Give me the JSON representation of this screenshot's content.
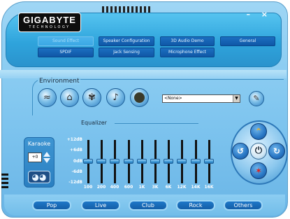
{
  "app": {
    "brand": "GIGABYTE",
    "brand_sub": "TECHNOLOGY",
    "window_controls": "– ×"
  },
  "tabs": [
    {
      "label": "Sound Effect",
      "active": true
    },
    {
      "label": "Speaker Configuration",
      "active": false
    },
    {
      "label": "3D Audio Demo",
      "active": false
    },
    {
      "label": "General",
      "active": false
    },
    {
      "label": "SPDIF",
      "active": false
    },
    {
      "label": "Jack Sensing",
      "active": false
    },
    {
      "label": "Microphone Effect",
      "active": false
    }
  ],
  "environment": {
    "title": "Environment",
    "selected": "<None>",
    "icons": [
      "stone-room-icon",
      "sewer-icon",
      "bathroom-icon",
      "theater-icon",
      "stadium-icon"
    ],
    "edit_icon": "edit-icon"
  },
  "equalizer": {
    "title": "Equalizer",
    "db_labels": [
      "+12dB",
      "+6dB",
      "0dB",
      "-6dB",
      "-12dB"
    ],
    "bands": [
      "100",
      "200",
      "400",
      "600",
      "1K",
      "3K",
      "6K",
      "12K",
      "14K",
      "16K"
    ],
    "levels_db": [
      0,
      0,
      0,
      0,
      0,
      0,
      0,
      0,
      0,
      0
    ]
  },
  "karaoke": {
    "title": "Karaoke",
    "value": "+0"
  },
  "control_pad": {
    "up_icon": "arrow-up-icon",
    "left_icon": "rotate-left-icon",
    "right_icon": "rotate-right-icon",
    "down_icon": "star-icon",
    "center_icon": "power-icon"
  },
  "presets": [
    "Pop",
    "Live",
    "Club",
    "Rock",
    "Others"
  ],
  "colors": {
    "panel": "#2fa4dc",
    "body": "#8ccdf2",
    "button": "#145ea8"
  }
}
